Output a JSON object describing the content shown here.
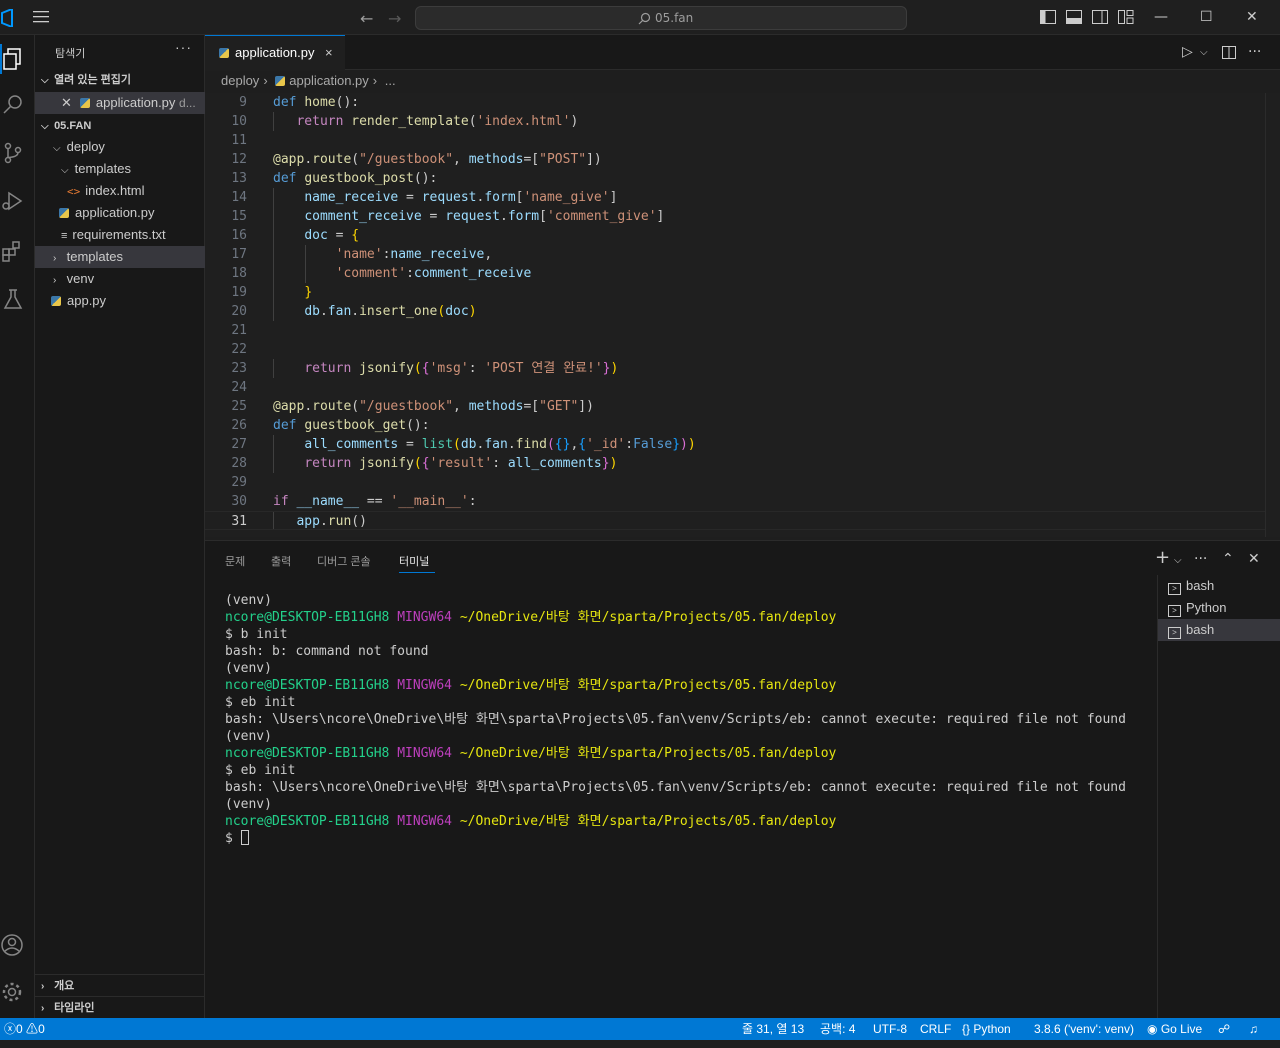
{
  "titlebar": {
    "search_text": "05.fan"
  },
  "sidebar": {
    "title": "탐색기",
    "more": "···",
    "open_editors_label": "열려 있는 편집기",
    "open_editor_item": "application.py",
    "open_editor_suffix": "d...",
    "workspace_label": "05.FAN",
    "tree": [
      {
        "label": "deploy",
        "kind": "folder",
        "expanded": true
      },
      {
        "label": "templates",
        "kind": "folder",
        "expanded": true
      },
      {
        "label": "index.html",
        "kind": "html"
      },
      {
        "label": "application.py",
        "kind": "python"
      },
      {
        "label": "requirements.txt",
        "kind": "text"
      },
      {
        "label": "templates",
        "kind": "folder",
        "expanded": false
      },
      {
        "label": "venv",
        "kind": "folder",
        "expanded": false
      },
      {
        "label": "app.py",
        "kind": "python"
      }
    ],
    "outline_label": "개요",
    "timeline_label": "타임라인"
  },
  "editor": {
    "tab_label": "application.py",
    "tab_close": "×",
    "breadcrumb": [
      "deploy",
      "application.py",
      "..."
    ],
    "lines": [
      {
        "n": "9",
        "tokens": [
          [
            "k",
            "def "
          ],
          [
            "f",
            "home"
          ],
          [
            "p",
            "():"
          ]
        ]
      },
      {
        "n": "10",
        "tokens": [
          [
            "p",
            "   "
          ],
          [
            "kw2",
            "return "
          ],
          [
            "f",
            "render_template"
          ],
          [
            "p",
            "("
          ],
          [
            "s",
            "'index.html'"
          ],
          [
            "p",
            ")"
          ]
        ]
      },
      {
        "n": "11",
        "tokens": []
      },
      {
        "n": "12",
        "tokens": [
          [
            "f",
            "@app"
          ],
          [
            "p",
            "."
          ],
          [
            "f",
            "route"
          ],
          [
            "p",
            "("
          ],
          [
            "s",
            "\"/guestbook\""
          ],
          [
            "p",
            ", "
          ],
          [
            "v",
            "methods"
          ],
          [
            "p",
            "=["
          ],
          [
            "s",
            "\"POST\""
          ],
          [
            "p",
            "])"
          ]
        ]
      },
      {
        "n": "13",
        "tokens": [
          [
            "k",
            "def "
          ],
          [
            "f",
            "guestbook_post"
          ],
          [
            "p",
            "():"
          ]
        ]
      },
      {
        "n": "14",
        "tokens": [
          [
            "p",
            "    "
          ],
          [
            "v",
            "name_receive"
          ],
          [
            "p",
            " = "
          ],
          [
            "v",
            "request"
          ],
          [
            "p",
            "."
          ],
          [
            "v",
            "form"
          ],
          [
            "p",
            "["
          ],
          [
            "s",
            "'name_give'"
          ],
          [
            "p",
            "]"
          ]
        ]
      },
      {
        "n": "15",
        "tokens": [
          [
            "p",
            "    "
          ],
          [
            "v",
            "comment_receive"
          ],
          [
            "p",
            " = "
          ],
          [
            "v",
            "request"
          ],
          [
            "p",
            "."
          ],
          [
            "v",
            "form"
          ],
          [
            "p",
            "["
          ],
          [
            "s",
            "'comment_give'"
          ],
          [
            "p",
            "]"
          ]
        ]
      },
      {
        "n": "16",
        "tokens": [
          [
            "p",
            "    "
          ],
          [
            "v",
            "doc"
          ],
          [
            "p",
            " = "
          ],
          [
            "b1",
            "{"
          ]
        ]
      },
      {
        "n": "17",
        "tokens": [
          [
            "p",
            "        "
          ],
          [
            "s",
            "'name'"
          ],
          [
            "p",
            ":"
          ],
          [
            "v",
            "name_receive"
          ],
          [
            "p",
            ","
          ]
        ]
      },
      {
        "n": "18",
        "tokens": [
          [
            "p",
            "        "
          ],
          [
            "s",
            "'comment'"
          ],
          [
            "p",
            ":"
          ],
          [
            "v",
            "comment_receive"
          ]
        ]
      },
      {
        "n": "19",
        "tokens": [
          [
            "p",
            "    "
          ],
          [
            "b1",
            "}"
          ]
        ]
      },
      {
        "n": "20",
        "tokens": [
          [
            "p",
            "    "
          ],
          [
            "v",
            "db"
          ],
          [
            "p",
            "."
          ],
          [
            "v",
            "fan"
          ],
          [
            "p",
            "."
          ],
          [
            "f",
            "insert_one"
          ],
          [
            "b1",
            "("
          ],
          [
            "v",
            "doc"
          ],
          [
            "b1",
            ")"
          ]
        ]
      },
      {
        "n": "21",
        "tokens": []
      },
      {
        "n": "22",
        "tokens": []
      },
      {
        "n": "23",
        "tokens": [
          [
            "p",
            "    "
          ],
          [
            "kw2",
            "return "
          ],
          [
            "f",
            "jsonify"
          ],
          [
            "b1",
            "("
          ],
          [
            "b2",
            "{"
          ],
          [
            "s",
            "'msg'"
          ],
          [
            "p",
            ": "
          ],
          [
            "s",
            "'POST 연결 완료!'"
          ],
          [
            "b2",
            "}"
          ],
          [
            "b1",
            ")"
          ]
        ]
      },
      {
        "n": "24",
        "tokens": []
      },
      {
        "n": "25",
        "tokens": [
          [
            "f",
            "@app"
          ],
          [
            "p",
            "."
          ],
          [
            "f",
            "route"
          ],
          [
            "p",
            "("
          ],
          [
            "s",
            "\"/guestbook\""
          ],
          [
            "p",
            ", "
          ],
          [
            "v",
            "methods"
          ],
          [
            "p",
            "=["
          ],
          [
            "s",
            "\"GET\""
          ],
          [
            "p",
            "])"
          ]
        ]
      },
      {
        "n": "26",
        "tokens": [
          [
            "k",
            "def "
          ],
          [
            "f",
            "guestbook_get"
          ],
          [
            "p",
            "():"
          ]
        ]
      },
      {
        "n": "27",
        "tokens": [
          [
            "p",
            "    "
          ],
          [
            "v",
            "all_comments"
          ],
          [
            "p",
            " = "
          ],
          [
            "t",
            "list"
          ],
          [
            "b1",
            "("
          ],
          [
            "v",
            "db"
          ],
          [
            "p",
            "."
          ],
          [
            "v",
            "fan"
          ],
          [
            "p",
            "."
          ],
          [
            "f",
            "find"
          ],
          [
            "b2",
            "("
          ],
          [
            "b3",
            "{}"
          ],
          [
            "p",
            ","
          ],
          [
            "b3",
            "{"
          ],
          [
            "s",
            "'_id'"
          ],
          [
            "p",
            ":"
          ],
          [
            "k",
            "False"
          ],
          [
            "b3",
            "}"
          ],
          [
            "b2",
            ")"
          ],
          [
            "b1",
            ")"
          ]
        ]
      },
      {
        "n": "28",
        "tokens": [
          [
            "p",
            "    "
          ],
          [
            "kw2",
            "return "
          ],
          [
            "f",
            "jsonify"
          ],
          [
            "b1",
            "("
          ],
          [
            "b2",
            "{"
          ],
          [
            "s",
            "'result'"
          ],
          [
            "p",
            ": "
          ],
          [
            "v",
            "all_comments"
          ],
          [
            "b2",
            "}"
          ],
          [
            "b1",
            ")"
          ]
        ]
      },
      {
        "n": "29",
        "tokens": []
      },
      {
        "n": "30",
        "tokens": [
          [
            "kw2",
            "if "
          ],
          [
            "v",
            "__name__"
          ],
          [
            "p",
            " == "
          ],
          [
            "s",
            "'__main__'"
          ],
          [
            "p",
            ":"
          ]
        ]
      },
      {
        "n": "31",
        "tokens": [
          [
            "p",
            "   "
          ],
          [
            "v",
            "app"
          ],
          [
            "p",
            "."
          ],
          [
            "f",
            "run"
          ],
          [
            "p",
            "()"
          ]
        ]
      }
    ]
  },
  "panel": {
    "tabs": [
      "문제",
      "출력",
      "디버그 콘솔",
      "터미널"
    ],
    "active_tab": "터미널",
    "add_icon": "+",
    "terminal_lines": [
      {
        "type": "plain",
        "text": "(venv)"
      },
      {
        "type": "prompt",
        "user": "ncore@DESKTOP-EB11GH8",
        "sys": "MINGW64",
        "path": "~/OneDrive/바탕 화면/sparta/Projects/05.fan/deploy"
      },
      {
        "type": "plain",
        "text": "$ b init"
      },
      {
        "type": "plain",
        "text": "bash: b: command not found"
      },
      {
        "type": "plain",
        "text": "(venv)"
      },
      {
        "type": "prompt",
        "user": "ncore@DESKTOP-EB11GH8",
        "sys": "MINGW64",
        "path": "~/OneDrive/바탕 화면/sparta/Projects/05.fan/deploy"
      },
      {
        "type": "plain",
        "text": "$ eb init"
      },
      {
        "type": "plain",
        "text": "bash: \\Users\\ncore\\OneDrive\\바탕 화면\\sparta\\Projects\\05.fan\\venv/Scripts/eb: cannot execute: required file not found"
      },
      {
        "type": "plain",
        "text": "(venv)"
      },
      {
        "type": "prompt",
        "user": "ncore@DESKTOP-EB11GH8",
        "sys": "MINGW64",
        "path": "~/OneDrive/바탕 화면/sparta/Projects/05.fan/deploy"
      },
      {
        "type": "plain",
        "text": "$ eb init"
      },
      {
        "type": "plain",
        "text": "bash: \\Users\\ncore\\OneDrive\\바탕 화면\\sparta\\Projects\\05.fan\\venv/Scripts/eb: cannot execute: required file not found"
      },
      {
        "type": "plain",
        "text": "(venv)"
      },
      {
        "type": "prompt",
        "user": "ncore@DESKTOP-EB11GH8",
        "sys": "MINGW64",
        "path": "~/OneDrive/바탕 화면/sparta/Projects/05.fan/deploy"
      },
      {
        "type": "input",
        "text": "$ "
      }
    ],
    "terminals": [
      "bash",
      "Python",
      "bash"
    ],
    "selected_terminal": 2
  },
  "statusbar": {
    "errors": "0",
    "warnings": "0",
    "position": "줄 31, 열 13",
    "indent": "공백: 4",
    "encoding": "UTF-8",
    "eol": "CRLF",
    "language": "Python",
    "interpreter": "3.8.6 ('venv': venv)",
    "golive": "Go Live"
  },
  "colors": {
    "accent": "#0078d4",
    "background": "#1f1f1f",
    "sidebar": "#181818"
  }
}
